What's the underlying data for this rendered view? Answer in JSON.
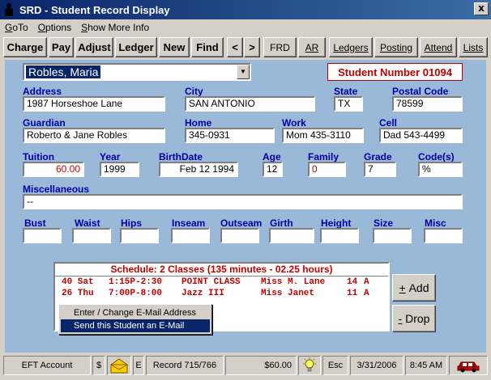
{
  "window": {
    "title": "SRD - Student Record Display",
    "close_label": "x"
  },
  "menu": [
    {
      "key": "G",
      "rest": "oTo"
    },
    {
      "key": "O",
      "rest": "ptions"
    },
    {
      "key": "S",
      "rest": "how More Info"
    }
  ],
  "toolbar": {
    "charge": "Charge",
    "pay": "Pay",
    "adjust": "Adjust",
    "ledger": "Ledger",
    "new": "New",
    "find": "Find",
    "prev": "<",
    "next": ">",
    "frd": "FRD",
    "ar": "AR",
    "ledgers": "Ledgers",
    "posting": "Posting",
    "attend": "Attend",
    "lists": "Lists"
  },
  "student": {
    "name": "Robles, Maria",
    "number_label": "Student Number 01094"
  },
  "labels": {
    "address": "Address",
    "city": "City",
    "state": "State",
    "postal": "Postal Code",
    "guardian": "Guardian",
    "home": "Home",
    "work": "Work",
    "cell": "Cell",
    "tuition": "Tuition",
    "year": "Year",
    "birthdate": "BirthDate",
    "age": "Age",
    "family": "Family",
    "grade": "Grade",
    "codes": "Code(s)",
    "misc": "Miscellaneous",
    "bust": "Bust",
    "waist": "Waist",
    "hips": "Hips",
    "inseam": "Inseam",
    "outseam": "Outseam",
    "girth": "Girth",
    "height": "Height",
    "size": "Size",
    "misc2": "Misc"
  },
  "values": {
    "address": "1987 Horseshoe Lane",
    "city": "SAN ANTONIO",
    "state": "TX",
    "postal": "78599",
    "guardian": "Roberto & Jane Robles",
    "home": "345-0931",
    "work": "Mom 435-3110",
    "cell": "Dad 543-4499",
    "tuition": "60.00",
    "year": "1999",
    "birthdate": "Feb 12 1994",
    "age": "12",
    "family": "0",
    "grade": "7",
    "codes": "%",
    "misc": "--"
  },
  "schedule": {
    "title": "Schedule: 2 Classes (135 minutes - 02.25 hours)",
    "rows": [
      {
        "day": "40 Sat",
        "time": "1:15P-2:30",
        "class": "POINT CLASS",
        "teacher": "Miss M. Lane",
        "room": "14",
        "code": "A"
      },
      {
        "day": "26 Thu",
        "time": "7:00P-8:00",
        "class": "Jazz III",
        "teacher": "Miss Janet",
        "room": "11",
        "code": "A"
      }
    ],
    "add_label": "Add",
    "drop_label": "Drop"
  },
  "context_menu": {
    "item1": "Enter / Change E-Mail Address",
    "item2": "Send this Student an E-Mail"
  },
  "status": {
    "eft": "EFT Account",
    "dollar": "$",
    "e": "E",
    "record": "Record 715/766",
    "amount": "$60.00",
    "esc": "Esc",
    "date": "3/31/2006",
    "time": "8:45 AM"
  },
  "icons": {
    "app": "person-icon",
    "envelope": "envelope-icon",
    "bulb": "lightbulb-icon",
    "car": "car-icon"
  },
  "colors": {
    "panel_bg": "#9ab9d8",
    "label_blue": "#0000a0",
    "accent_red": "#c00000",
    "title_bar": "#0a246a"
  }
}
